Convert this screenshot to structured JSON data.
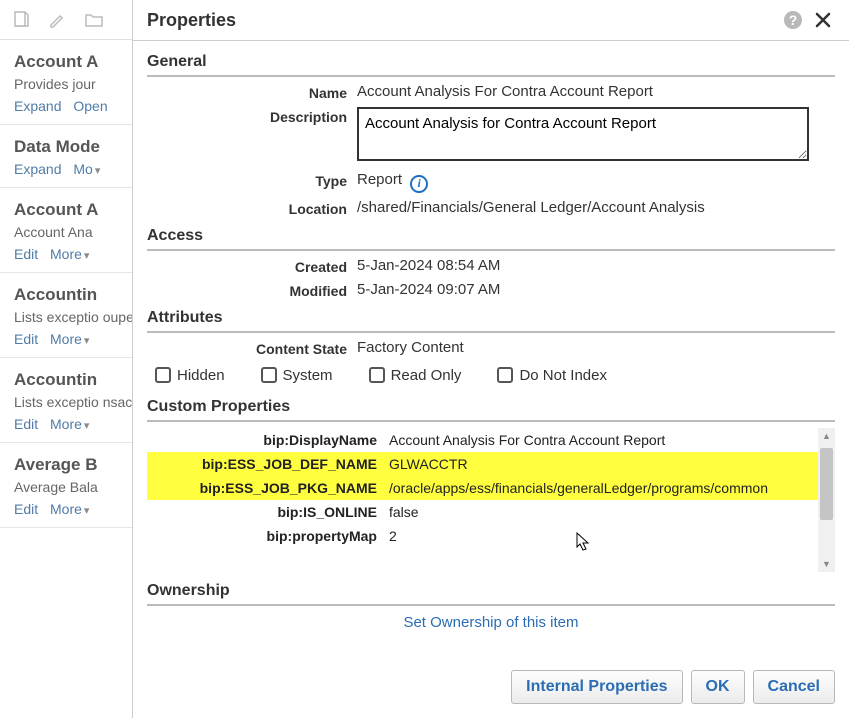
{
  "bg_toolbar_icons": [
    "doc-icon",
    "pencil-icon",
    "folder-icon"
  ],
  "bg_items": [
    {
      "title": "Account A",
      "desc": "Provides jour",
      "links": [
        "Expand",
        "Open"
      ]
    },
    {
      "title": "Data Mode",
      "desc": "",
      "links": [
        "Expand",
        "Mo"
      ]
    },
    {
      "title": "Account A",
      "desc": "Account Ana",
      "links": [
        "Edit",
        "More"
      ]
    },
    {
      "title": "Accountin",
      "desc": "Lists exceptio ouped by typ",
      "links": [
        "Edit",
        "More"
      ]
    },
    {
      "title": "Accountin",
      "desc": "Lists exceptio nsaction deta",
      "links": [
        "Edit",
        "More"
      ]
    },
    {
      "title": "Average B",
      "desc": "Average Bala",
      "links": [
        "Edit",
        "More"
      ]
    }
  ],
  "dialog": {
    "title": "Properties",
    "sections": {
      "general": "General",
      "access": "Access",
      "attributes": "Attributes",
      "custom": "Custom Properties",
      "ownership": "Ownership"
    },
    "general": {
      "name_label": "Name",
      "name_value": "Account Analysis For Contra Account Report",
      "desc_label": "Description",
      "desc_value": "Account Analysis for Contra Account Report",
      "type_label": "Type",
      "type_value": "Report",
      "location_label": "Location",
      "location_value": "/shared/Financials/General Ledger/Account Analysis"
    },
    "access": {
      "created_label": "Created",
      "created_value": "5-Jan-2024 08:54 AM",
      "modified_label": "Modified",
      "modified_value": "5-Jan-2024 09:07 AM"
    },
    "attributes": {
      "content_state_label": "Content State",
      "content_state_value": "Factory Content",
      "checks": [
        "Hidden",
        "System",
        "Read Only",
        "Do Not Index"
      ]
    },
    "custom": [
      {
        "k": "bip:DisplayName",
        "v": "Account Analysis For Contra Account Report",
        "hi": false
      },
      {
        "k": "bip:ESS_JOB_DEF_NAME",
        "v": "GLWACCTR",
        "hi": true
      },
      {
        "k": "bip:ESS_JOB_PKG_NAME",
        "v": "/oracle/apps/ess/financials/generalLedger/programs/common",
        "hi": true
      },
      {
        "k": "bip:IS_ONLINE",
        "v": "false",
        "hi": false
      },
      {
        "k": "bip:propertyMap",
        "v": "2",
        "hi": false
      }
    ],
    "ownership_link": "Set Ownership of this item",
    "buttons": {
      "internal": "Internal Properties",
      "ok": "OK",
      "cancel": "Cancel"
    }
  }
}
